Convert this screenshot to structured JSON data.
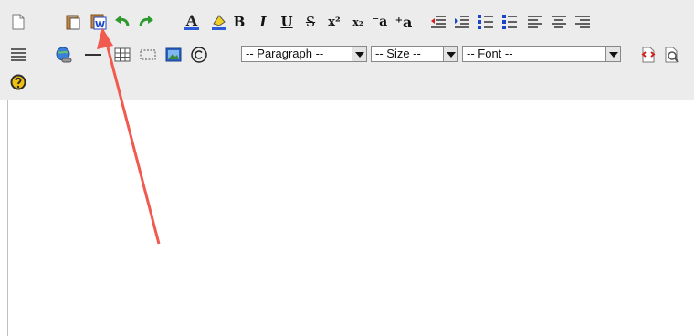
{
  "toolbar": {
    "paragraph_select": "-- Paragraph --",
    "size_select": "-- Size --",
    "font_select": "-- Font --",
    "text_buttons": {
      "bold": "B",
      "italic": "I",
      "underline": "U",
      "strike": "S",
      "superscript": "x²",
      "subscript": "x₂",
      "font_smaller": "⁻a",
      "font_larger": "⁺a"
    }
  },
  "colors": {
    "toolbar_bg": "#ececec",
    "accent_blue": "#1a45c8",
    "undo_green": "#2e9a2e",
    "annotation_arrow": "#f05a4f"
  }
}
